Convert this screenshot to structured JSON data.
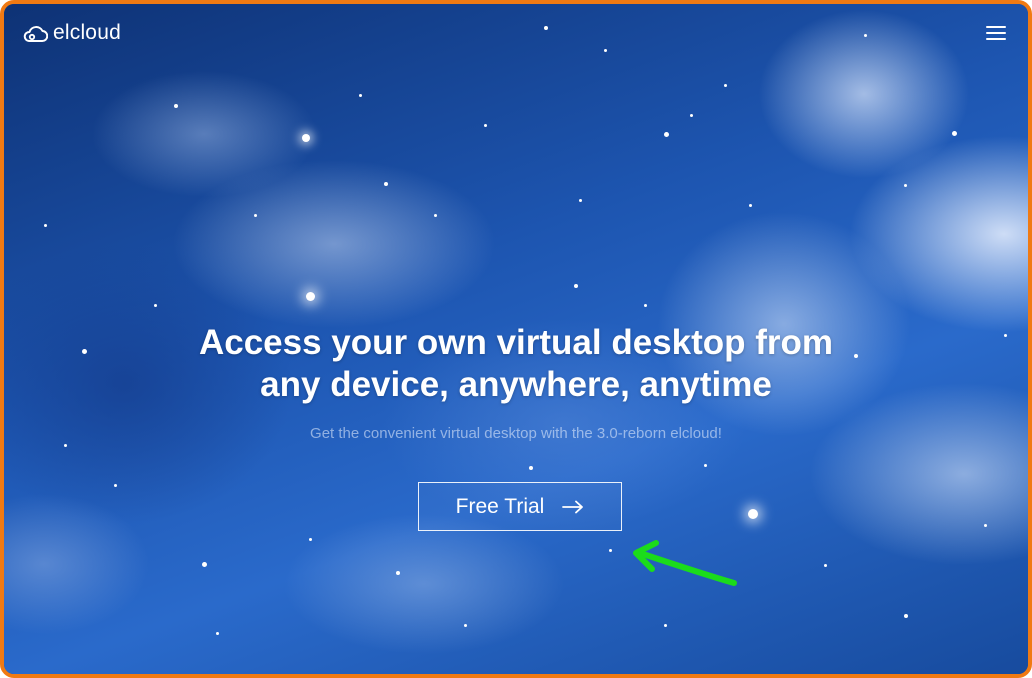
{
  "header": {
    "logo_text": "elcloud",
    "logo_icon": "cloud-icon",
    "menu_icon": "hamburger-menu-icon"
  },
  "hero": {
    "title_line1": "Access your own virtual desktop from",
    "title_line2": "any device, anywhere, anytime",
    "subtitle": "Get the convenient virtual desktop with the 3.0-reborn elcloud!"
  },
  "cta": {
    "label": "Free Trial",
    "icon": "arrow-right-icon"
  },
  "annotation": {
    "icon": "green-arrow-pointer-icon",
    "color": "#1bdc1b"
  },
  "colors": {
    "frame_border": "#f07a13",
    "sky_dark": "#0e3275",
    "sky_mid": "#2a6acb",
    "text": "#ffffff"
  }
}
